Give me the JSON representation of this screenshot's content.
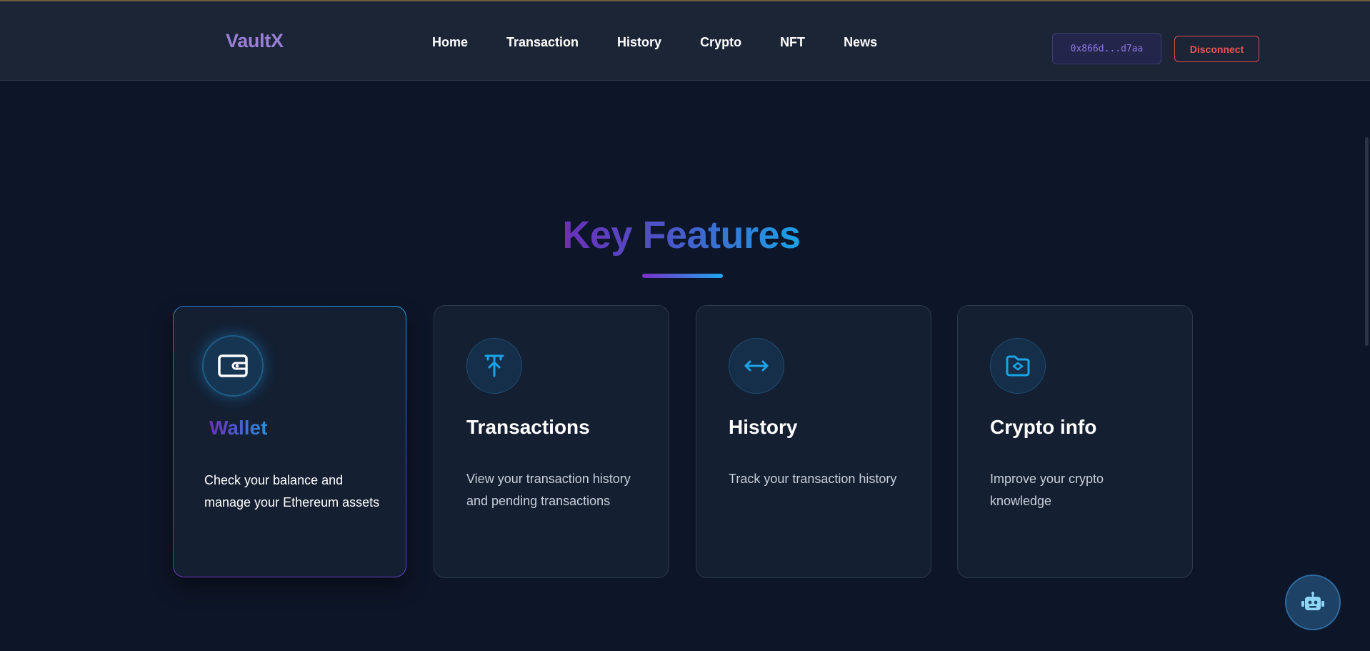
{
  "navbar": {
    "logo": "VaultX",
    "links": [
      "Home",
      "Transaction",
      "History",
      "Crypto",
      "NFT",
      "News"
    ],
    "wallet_address": "0x866d...d7aa",
    "disconnect_label": "Disconnect"
  },
  "features": {
    "title": "Key Features",
    "cards": [
      {
        "icon": "wallet-icon",
        "title": "Wallet",
        "description": "Check your balance and manage your Ethereum assets"
      },
      {
        "icon": "upload-arrow-icon",
        "title": "Transactions",
        "description": "View your transaction history and pending transactions"
      },
      {
        "icon": "arrows-left-right-icon",
        "title": "History",
        "description": "Track your transaction history"
      },
      {
        "icon": "folder-icon",
        "title": "Crypto info",
        "description": "Improve your crypto knowledge"
      }
    ]
  },
  "chat_button": {
    "icon": "robot-icon"
  },
  "colors": {
    "background": "#0d1628",
    "navbar": "#1b2536",
    "card": "#141f31",
    "accent_blue": "#1ba3e6",
    "accent_purple": "#6b2fb8",
    "danger": "#e04b4b"
  }
}
